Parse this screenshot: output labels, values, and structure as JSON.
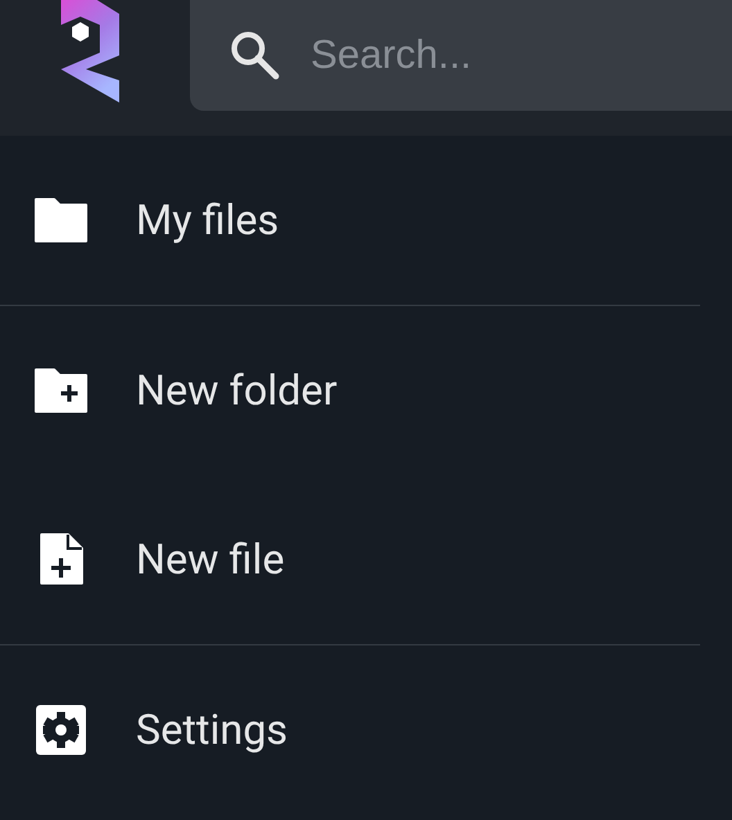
{
  "search": {
    "placeholder": "Search..."
  },
  "menu_groups": [
    [
      {
        "label": "My files",
        "kind": "folder"
      }
    ],
    [
      {
        "label": "New folder",
        "kind": "new-folder"
      },
      {
        "label": "New file",
        "kind": "new-file"
      }
    ],
    [
      {
        "label": "Settings",
        "kind": "settings"
      }
    ]
  ]
}
